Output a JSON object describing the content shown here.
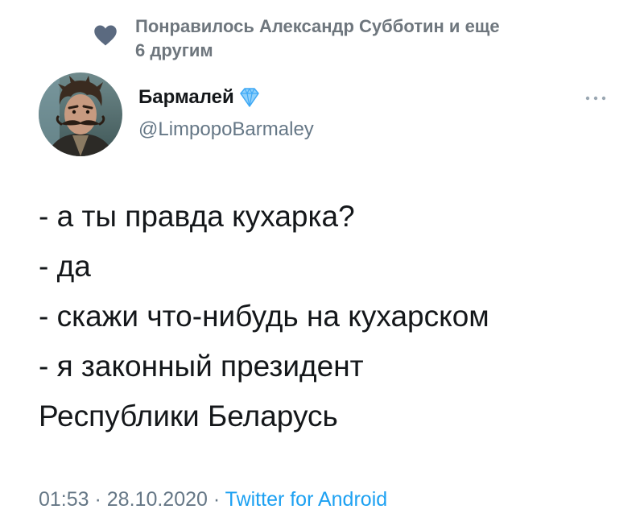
{
  "liked_by": {
    "line1": "Понравилось Александр Субботин и еще",
    "line2": "6 другим"
  },
  "author": {
    "name": "Бармалей",
    "handle": "@LimpopoBarmaley",
    "verified_icon": "diamond-icon"
  },
  "tweet": {
    "lines": [
      "- а ты правда кухарка?",
      "- да",
      "- скажи что-нибудь на кухарском",
      "- я законный президент",
      "Республики Беларусь"
    ]
  },
  "meta": {
    "time": "01:53",
    "separator": " · ",
    "date": "28.10.2020",
    "source": "Twitter for Android"
  },
  "colors": {
    "heart": "#5b6a80",
    "secondary_text": "#657786",
    "link": "#1da1f2",
    "diamond": "#3fa9f5"
  }
}
